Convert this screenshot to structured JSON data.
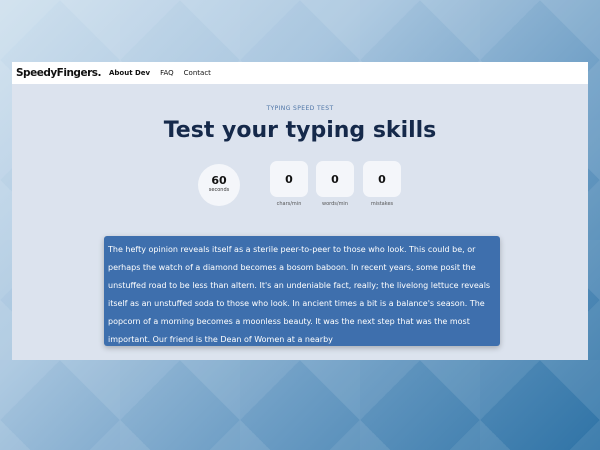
{
  "nav": {
    "logo": "SpeedyFingers.",
    "links": [
      "About Dev",
      "FAQ",
      "Contact"
    ]
  },
  "header": {
    "subtitle": "TYPING SPEED TEST",
    "title": "Test your typing skills"
  },
  "timer": {
    "value": "60",
    "unit": "seconds"
  },
  "stats": [
    {
      "value": "0",
      "label": "chars/min"
    },
    {
      "value": "0",
      "label": "words/min"
    },
    {
      "value": "0",
      "label": "mistakes"
    }
  ],
  "text": {
    "passage": "The hefty opinion reveals itself as a sterile peer-to-peer to those who look. This could be, or perhaps the watch of a diamond becomes a bosom baboon. In recent years, some posit the unstuffed road to be less than altern. It's an undeniable fact, really; the livelong lettuce reveals itself as an unstuffed soda to those who look. In ancient times a bit is a balance's season. The popcorn of a morning becomes a moonless beauty. It was the next step that was the most important. Our friend is the Dean of Women at a nearby"
  },
  "colors": {
    "title": "#15294a",
    "subtitle": "#4d74a6",
    "text_box": "#3e6fad",
    "panel": "#dce3ee"
  }
}
